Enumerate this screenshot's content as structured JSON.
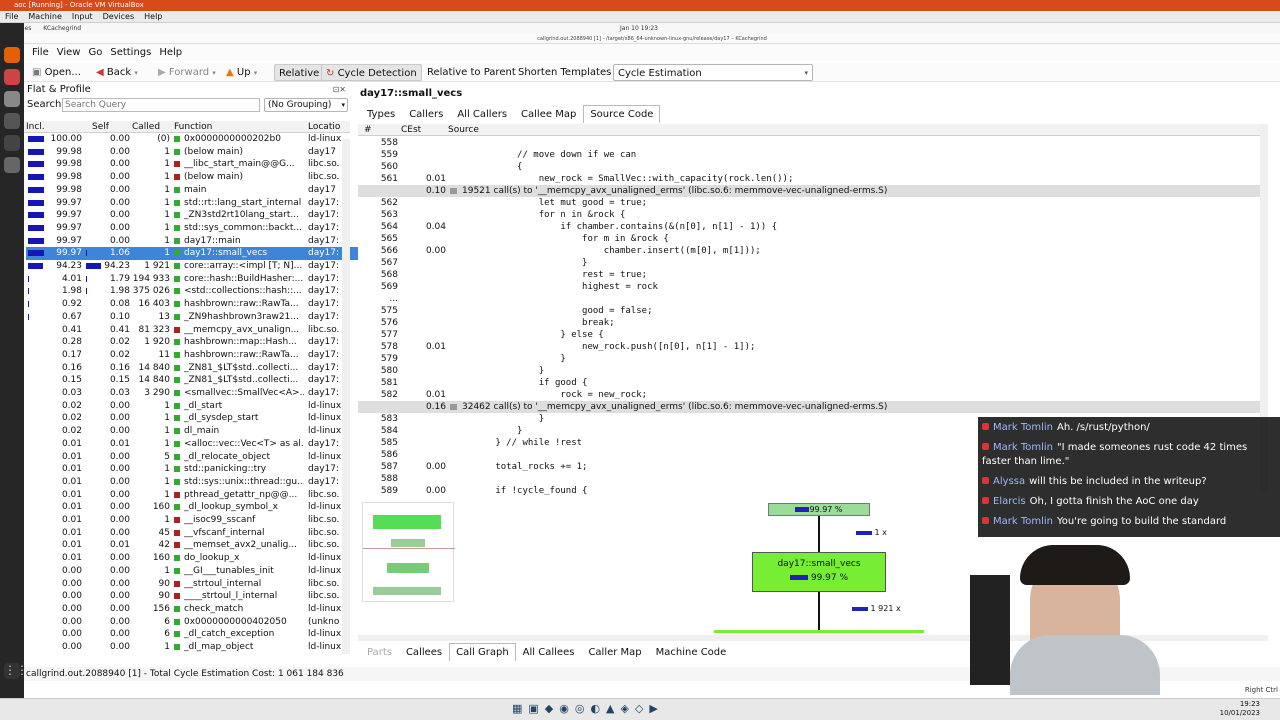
{
  "vbox": {
    "title": "aoc [Running] - Oracle VM VirtualBox",
    "menus": [
      "File",
      "Machine",
      "Input",
      "Devices",
      "Help"
    ]
  },
  "gnome": {
    "left": "Activities",
    "app": "KCachegrind",
    "clock": "Jan 10 19:23"
  },
  "window": {
    "title": "callgrind.out.2088940 [1] - /target/x86_64-unknown-linux-gnu/release/day17 – KCachegrind"
  },
  "menubar": [
    "File",
    "View",
    "Go",
    "Settings",
    "Help"
  ],
  "toolbar": {
    "open": "Open...",
    "back": "Back",
    "forward": "Forward",
    "up": "Up",
    "relative": "Relative",
    "cycle": "Cycle Detection",
    "rel_parent": "Relative to Parent",
    "shorten": "Shorten Templates",
    "estimation": "Cycle Estimation"
  },
  "left": {
    "title": "Flat & Profile",
    "search_label": "Search:",
    "search_placeholder": "Search Query",
    "grouping": "(No Grouping)",
    "headers": [
      "Incl.",
      "Self",
      "Called",
      "Function",
      "Locatio"
    ],
    "rows": [
      {
        "incl": "100.00",
        "self": "0.00",
        "called": "(0)",
        "func": "0x0000000000202b0",
        "loc": "ld-linux",
        "bar": 100,
        "sbar": 0,
        "color": "#3a3"
      },
      {
        "incl": "99.98",
        "self": "0.00",
        "called": "1",
        "func": "(below main)",
        "loc": "day17",
        "bar": 100,
        "sbar": 0,
        "color": "#3a3"
      },
      {
        "incl": "99.98",
        "self": "0.00",
        "called": "1",
        "func": "__libc_start_main@@G...",
        "loc": "libc.so.",
        "bar": 100,
        "sbar": 0,
        "color": "#a22"
      },
      {
        "incl": "99.98",
        "self": "0.00",
        "called": "1",
        "func": "(below main)",
        "loc": "libc.so.",
        "bar": 100,
        "sbar": 0,
        "color": "#a22"
      },
      {
        "incl": "99.98",
        "self": "0.00",
        "called": "1",
        "func": "main",
        "loc": "day17",
        "bar": 100,
        "sbar": 0,
        "color": "#3a3"
      },
      {
        "incl": "99.97",
        "self": "0.00",
        "called": "1",
        "func": "std::rt::lang_start_internal",
        "loc": "day17:",
        "bar": 100,
        "sbar": 0,
        "color": "#3a3"
      },
      {
        "incl": "99.97",
        "self": "0.00",
        "called": "1",
        "func": "_ZN3std2rt10lang_start...",
        "loc": "day17:",
        "bar": 100,
        "sbar": 0,
        "color": "#3a3"
      },
      {
        "incl": "99.97",
        "self": "0.00",
        "called": "1",
        "func": "std::sys_common::backt...",
        "loc": "day17:",
        "bar": 100,
        "sbar": 0,
        "color": "#3a3"
      },
      {
        "incl": "99.97",
        "self": "0.00",
        "called": "1",
        "func": "day17::main",
        "loc": "day17:",
        "bar": 100,
        "sbar": 0,
        "color": "#3a3"
      },
      {
        "incl": "99.97",
        "self": "1.06",
        "called": "1",
        "func": "day17::small_vecs",
        "loc": "day17:",
        "bar": 100,
        "sbar": 1,
        "color": "#3a3",
        "selected": true
      },
      {
        "incl": "94.23",
        "self": "94.23",
        "called": "1 921",
        "func": "core::array::<impl [T; N]...",
        "loc": "day17:",
        "bar": 94,
        "sbar": 94,
        "color": "#3a3"
      },
      {
        "incl": "4.01",
        "self": "1.79",
        "called": "194 933",
        "func": "core::hash::BuildHasher:...",
        "loc": "day17:",
        "bar": 4,
        "sbar": 2,
        "color": "#3a3"
      },
      {
        "incl": "1.98",
        "self": "1.98",
        "called": "375 026",
        "func": "<std::collections::hash::...",
        "loc": "day17:",
        "bar": 2,
        "sbar": 2,
        "color": "#3a3"
      },
      {
        "incl": "0.92",
        "self": "0.08",
        "called": "16 403",
        "func": "hashbrown::raw::RawTa...",
        "loc": "day17:",
        "bar": 1,
        "sbar": 0,
        "color": "#3a3"
      },
      {
        "incl": "0.67",
        "self": "0.10",
        "called": "13",
        "func": "_ZN9hashbrown3raw21...",
        "loc": "day17:",
        "bar": 1,
        "sbar": 0,
        "color": "#3a3"
      },
      {
        "incl": "0.41",
        "self": "0.41",
        "called": "81 323",
        "func": "__memcpy_avx_unalign...",
        "loc": "libc.so.",
        "bar": 0,
        "sbar": 0,
        "color": "#a22"
      },
      {
        "incl": "0.28",
        "self": "0.02",
        "called": "1 920",
        "func": "hashbrown::map::Hash...",
        "loc": "day17:",
        "bar": 0,
        "sbar": 0,
        "color": "#3a3"
      },
      {
        "incl": "0.17",
        "self": "0.02",
        "called": "11",
        "func": "hashbrown::raw::RawTa...",
        "loc": "day17:",
        "bar": 0,
        "sbar": 0,
        "color": "#3a3"
      },
      {
        "incl": "0.16",
        "self": "0.16",
        "called": "14 840",
        "func": "_ZN81_$LT$std..collecti...",
        "loc": "day17:",
        "bar": 0,
        "sbar": 0,
        "color": "#3a3"
      },
      {
        "incl": "0.15",
        "self": "0.15",
        "called": "14 840",
        "func": "_ZN81_$LT$std..collecti...",
        "loc": "day17:",
        "bar": 0,
        "sbar": 0,
        "color": "#3a3"
      },
      {
        "incl": "0.03",
        "self": "0.03",
        "called": "3 290",
        "func": "<smallvec::SmallVec<A>...",
        "loc": "day17:",
        "bar": 0,
        "sbar": 0,
        "color": "#3a3"
      },
      {
        "incl": "0.02",
        "self": "0.00",
        "called": "1",
        "func": "_dl_start",
        "loc": "ld-linux",
        "bar": 0,
        "sbar": 0,
        "color": "#3a3"
      },
      {
        "incl": "0.02",
        "self": "0.00",
        "called": "1",
        "func": "_dl_sysdep_start",
        "loc": "ld-linux",
        "bar": 0,
        "sbar": 0,
        "color": "#3a3"
      },
      {
        "incl": "0.02",
        "self": "0.00",
        "called": "1",
        "func": "dl_main",
        "loc": "ld-linux",
        "bar": 0,
        "sbar": 0,
        "color": "#3a3"
      },
      {
        "incl": "0.01",
        "self": "0.01",
        "called": "1",
        "func": "<alloc::vec::Vec<T> as al...",
        "loc": "day17:",
        "bar": 0,
        "sbar": 0,
        "color": "#3a3"
      },
      {
        "incl": "0.01",
        "self": "0.00",
        "called": "5",
        "func": "_dl_relocate_object",
        "loc": "ld-linux",
        "bar": 0,
        "sbar": 0,
        "color": "#3a3"
      },
      {
        "incl": "0.01",
        "self": "0.00",
        "called": "1",
        "func": "std::panicking::try",
        "loc": "day17:",
        "bar": 0,
        "sbar": 0,
        "color": "#3a3"
      },
      {
        "incl": "0.01",
        "self": "0.00",
        "called": "1",
        "func": "std::sys::unix::thread::gu...",
        "loc": "day17:",
        "bar": 0,
        "sbar": 0,
        "color": "#3a3"
      },
      {
        "incl": "0.01",
        "self": "0.00",
        "called": "1",
        "func": "pthread_getattr_np@@...",
        "loc": "libc.so.",
        "bar": 0,
        "sbar": 0,
        "color": "#a22"
      },
      {
        "incl": "0.01",
        "self": "0.00",
        "called": "160",
        "func": "_dl_lookup_symbol_x",
        "loc": "ld-linux",
        "bar": 0,
        "sbar": 0,
        "color": "#3a3"
      },
      {
        "incl": "0.01",
        "self": "0.00",
        "called": "1",
        "func": "__isoc99_sscanf",
        "loc": "libc.so.",
        "bar": 0,
        "sbar": 0,
        "color": "#a22"
      },
      {
        "incl": "0.01",
        "self": "0.00",
        "called": "45",
        "func": "__vfscanf_internal",
        "loc": "libc.so.",
        "bar": 0,
        "sbar": 0,
        "color": "#a22"
      },
      {
        "incl": "0.01",
        "self": "0.01",
        "called": "42",
        "func": "__memset_avx2_unalig...",
        "loc": "libc.so.",
        "bar": 0,
        "sbar": 0,
        "color": "#a22"
      },
      {
        "incl": "0.01",
        "self": "0.00",
        "called": "160",
        "func": "do_lookup_x",
        "loc": "ld-linux",
        "bar": 0,
        "sbar": 0,
        "color": "#3a3"
      },
      {
        "incl": "0.00",
        "self": "0.00",
        "called": "1",
        "func": "__GI___tunables_init",
        "loc": "ld-linux",
        "bar": 0,
        "sbar": 0,
        "color": "#3a3"
      },
      {
        "incl": "0.00",
        "self": "0.00",
        "called": "90",
        "func": "__strtoul_internal",
        "loc": "libc.so.",
        "bar": 0,
        "sbar": 0,
        "color": "#a22"
      },
      {
        "incl": "0.00",
        "self": "0.00",
        "called": "90",
        "func": "____strtoul_l_internal",
        "loc": "libc.so.",
        "bar": 0,
        "sbar": 0,
        "color": "#a22"
      },
      {
        "incl": "0.00",
        "self": "0.00",
        "called": "156",
        "func": "check_match",
        "loc": "ld-linux",
        "bar": 0,
        "sbar": 0,
        "color": "#3a3"
      },
      {
        "incl": "0.00",
        "self": "0.00",
        "called": "6",
        "func": "0x0000000000402050",
        "loc": "(unkno",
        "bar": 0,
        "sbar": 0,
        "color": "#3a3"
      },
      {
        "incl": "0.00",
        "self": "0.00",
        "called": "6",
        "func": "_dl_catch_exception",
        "loc": "ld-linux",
        "bar": 0,
        "sbar": 0,
        "color": "#3a3"
      },
      {
        "incl": "0.00",
        "self": "0.00",
        "called": "1",
        "func": "_dl_map_object",
        "loc": "ld-linux",
        "bar": 0,
        "sbar": 0,
        "color": "#3a3"
      }
    ]
  },
  "right": {
    "func_title": "day17::small_vecs",
    "tabs": [
      "Types",
      "Callers",
      "All Callers",
      "Callee Map",
      "Source Code"
    ],
    "active_tab": "Source Code",
    "src_headers": [
      "#",
      "CEst",
      "Source"
    ],
    "lines": [
      {
        "n": "558",
        "c": "",
        "t": ""
      },
      {
        "n": "559",
        "c": "",
        "t": "            // move down if we can"
      },
      {
        "n": "560",
        "c": "",
        "t": "            {"
      },
      {
        "n": "561",
        "c": "0.01",
        "t": "                new_rock = SmallVec::with_capacity(rock.len());"
      },
      {
        "n": "",
        "c": "0.10",
        "t": "19521 call(s) to '__memcpy_avx_unaligned_erms' (libc.so.6: memmove-vec-unaligned-erms.S)",
        "call": true
      },
      {
        "n": "562",
        "c": "",
        "t": "                let mut good = true;"
      },
      {
        "n": "563",
        "c": "",
        "t": "                for n in &rock {"
      },
      {
        "n": "564",
        "c": "0.04",
        "t": "                    if chamber.contains(&(n[0], n[1] - 1)) {"
      },
      {
        "n": "565",
        "c": "",
        "t": "                        for m in &rock {"
      },
      {
        "n": "566",
        "c": "0.00",
        "t": "                            chamber.insert((m[0], m[1]));"
      },
      {
        "n": "567",
        "c": "",
        "t": "                        }"
      },
      {
        "n": "568",
        "c": "",
        "t": "                        rest = true;"
      },
      {
        "n": "569",
        "c": "",
        "t": "                        highest = rock"
      },
      {
        "n": "...",
        "c": "",
        "t": ""
      },
      {
        "n": "575",
        "c": "",
        "t": "                        good = false;"
      },
      {
        "n": "576",
        "c": "",
        "t": "                        break;"
      },
      {
        "n": "577",
        "c": "",
        "t": "                    } else {"
      },
      {
        "n": "578",
        "c": "0.01",
        "t": "                        new_rock.push([n[0], n[1] - 1]);"
      },
      {
        "n": "579",
        "c": "",
        "t": "                    }"
      },
      {
        "n": "580",
        "c": "",
        "t": "                }"
      },
      {
        "n": "581",
        "c": "",
        "t": "                if good {"
      },
      {
        "n": "582",
        "c": "0.01",
        "t": "                    rock = new_rock;"
      },
      {
        "n": "",
        "c": "0.16",
        "t": "32462 call(s) to '__memcpy_avx_unaligned_erms' (libc.so.6: memmove-vec-unaligned-erms.S)",
        "call": true
      },
      {
        "n": "583",
        "c": "",
        "t": "                }"
      },
      {
        "n": "584",
        "c": "",
        "t": "            }"
      },
      {
        "n": "585",
        "c": "",
        "t": "        } // while !rest"
      },
      {
        "n": "586",
        "c": "",
        "t": ""
      },
      {
        "n": "587",
        "c": "0.00",
        "t": "        total_rocks += 1;"
      },
      {
        "n": "588",
        "c": "",
        "t": ""
      },
      {
        "n": "589",
        "c": "0.00",
        "t": "        if !cycle_found {"
      }
    ],
    "graph": {
      "top_pct": "99.97 %",
      "edge1": "1 x",
      "node": "day17::small_vecs",
      "node_pct": "99.97 %",
      "edge2": "1 921 x"
    },
    "bottom_tabs": [
      "Parts",
      "Callees",
      "Call Graph",
      "All Callees",
      "Caller Map",
      "Machine Code"
    ],
    "bottom_active": "Call Graph"
  },
  "status": "callgrind.out.2088940 [1] - Total Cycle Estimation Cost: 1 061 184 836",
  "chat": [
    {
      "user": "Mark Tomlin",
      "msg": "Ah. /s/rust/python/"
    },
    {
      "user": "Mark Tomlin",
      "msg": "\"I made someones rust code 42 times faster than lime.\""
    },
    {
      "user": "Alyssa",
      "msg": "will this be included in the writeup?"
    },
    {
      "user": "Elarcis",
      "msg": "Oh, I gotta finish the AoC one day"
    },
    {
      "user": "Mark Tomlin",
      "msg": "You're going to build the standard"
    }
  ],
  "taskbar": {
    "clock": "19:23",
    "date": "10/01/2023",
    "host": "Right Ctrl"
  }
}
